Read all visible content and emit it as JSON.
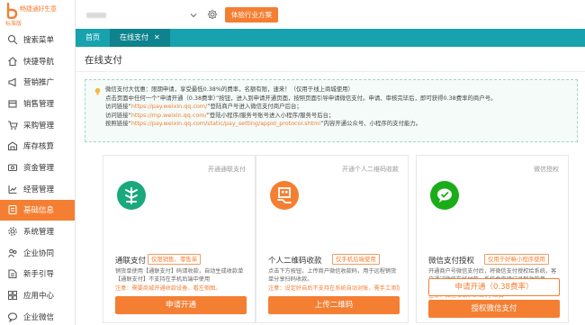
{
  "brand": {
    "title": "畅捷通好生意",
    "subtitle": "标准版",
    "color": "#f47f33"
  },
  "sidebar": {
    "items": [
      {
        "label": "搜索菜单",
        "icon": "search-icon"
      },
      {
        "label": "快捷导航",
        "icon": "home-icon"
      },
      {
        "label": "营销推广",
        "icon": "megaphone-icon"
      },
      {
        "label": "销售管理",
        "icon": "box-icon"
      },
      {
        "label": "采购管理",
        "icon": "cart-icon"
      },
      {
        "label": "库存核算",
        "icon": "warehouse-icon"
      },
      {
        "label": "资金管理",
        "icon": "money-icon"
      },
      {
        "label": "经营管理",
        "icon": "chart-icon"
      },
      {
        "label": "基础信息",
        "icon": "info-icon"
      },
      {
        "label": "系统管理",
        "icon": "gear-icon"
      },
      {
        "label": "企业协同",
        "icon": "team-icon"
      },
      {
        "label": "新手引导",
        "icon": "guide-icon"
      },
      {
        "label": "应用中心",
        "icon": "apps-icon"
      },
      {
        "label": "企业微信",
        "icon": "wecom-icon"
      }
    ],
    "active_index": 8
  },
  "topbar": {
    "plan_button": "体验行业方案"
  },
  "tabs": [
    {
      "label": "首页"
    },
    {
      "label": "在线支付",
      "close": "✕"
    }
  ],
  "page": {
    "title": "在线支付"
  },
  "notice": {
    "lines": [
      {
        "text": "微信支付大优惠：限期申请，享受最低0.38%的费率，名额有限，速来！（仅用于线上商城使用）"
      },
      {
        "text": "点击页面中任何一个“申请开通（0.38费率）”按钮，进入到申请开通页面，按照页面引导申请微信支付。申请、审核完毕后，即可获得0.38费率的商户号。"
      },
      {
        "prefix": "访问链接“",
        "link": "https://pay.weixin.qq.com/",
        "suffix": "”登陆商户号进入微信支付商户后台；"
      },
      {
        "prefix": "访问链接“",
        "link": "https://mp.weixin.qq.com/",
        "suffix": "”登陆小程序/服务号账号进入小程序/服务号后台；"
      },
      {
        "prefix": "按照链接“",
        "link": "https://pay.weixin.qq.com/static/pay_setting/appid_protocol.shtml",
        "suffix": "”内容开通公众号、小程序的支付能力。"
      }
    ]
  },
  "cards": [
    {
      "tag": "开通通联支付",
      "icon": "allinpay-logo-icon",
      "icon_bg": "#19a97b",
      "name": "通联支付",
      "badge": "仅限销售、零售单",
      "desc": "销货单使用【通联支付】码请收款，自动生成收款单【通联支付】不支持在手机后端中使用",
      "note": "注意：需要商城开通收款设备，看左侧图。",
      "buttons": [
        {
          "label": "申请开通",
          "style": "solid"
        }
      ]
    },
    {
      "tag": "开通个人二维码收款",
      "icon": "qrcode-hand-icon",
      "icon_bg": "#f47f33",
      "name": "个人二维码收款",
      "badge": "仅手机后端使用",
      "desc": "点击下方按钮，上传商户微信收款码，用于远程销货单分享扫码收款。",
      "note": "注意：设定好自后不支持在系统自动对账，需手工添加",
      "buttons": [
        {
          "label": "上传二维码",
          "style": "solid"
        }
      ]
    },
    {
      "tag": "微信授权",
      "icon": "wechat-pay-icon",
      "icon_bg": "#1aad19",
      "name": "微信支付授权",
      "badge": "仅用于好嘛小程序使用",
      "desc": "开通商户号微信支付后，将微信支付授权给系统，客户通过微信在线付款，系统会直接记录到收款单。",
      "note": "注意：微信收取0.6%的手续费",
      "buttons": [
        {
          "label": "申请开通（0.38费率）",
          "style": "outline"
        },
        {
          "label": "授权微信支付",
          "style": "solid"
        }
      ]
    }
  ]
}
